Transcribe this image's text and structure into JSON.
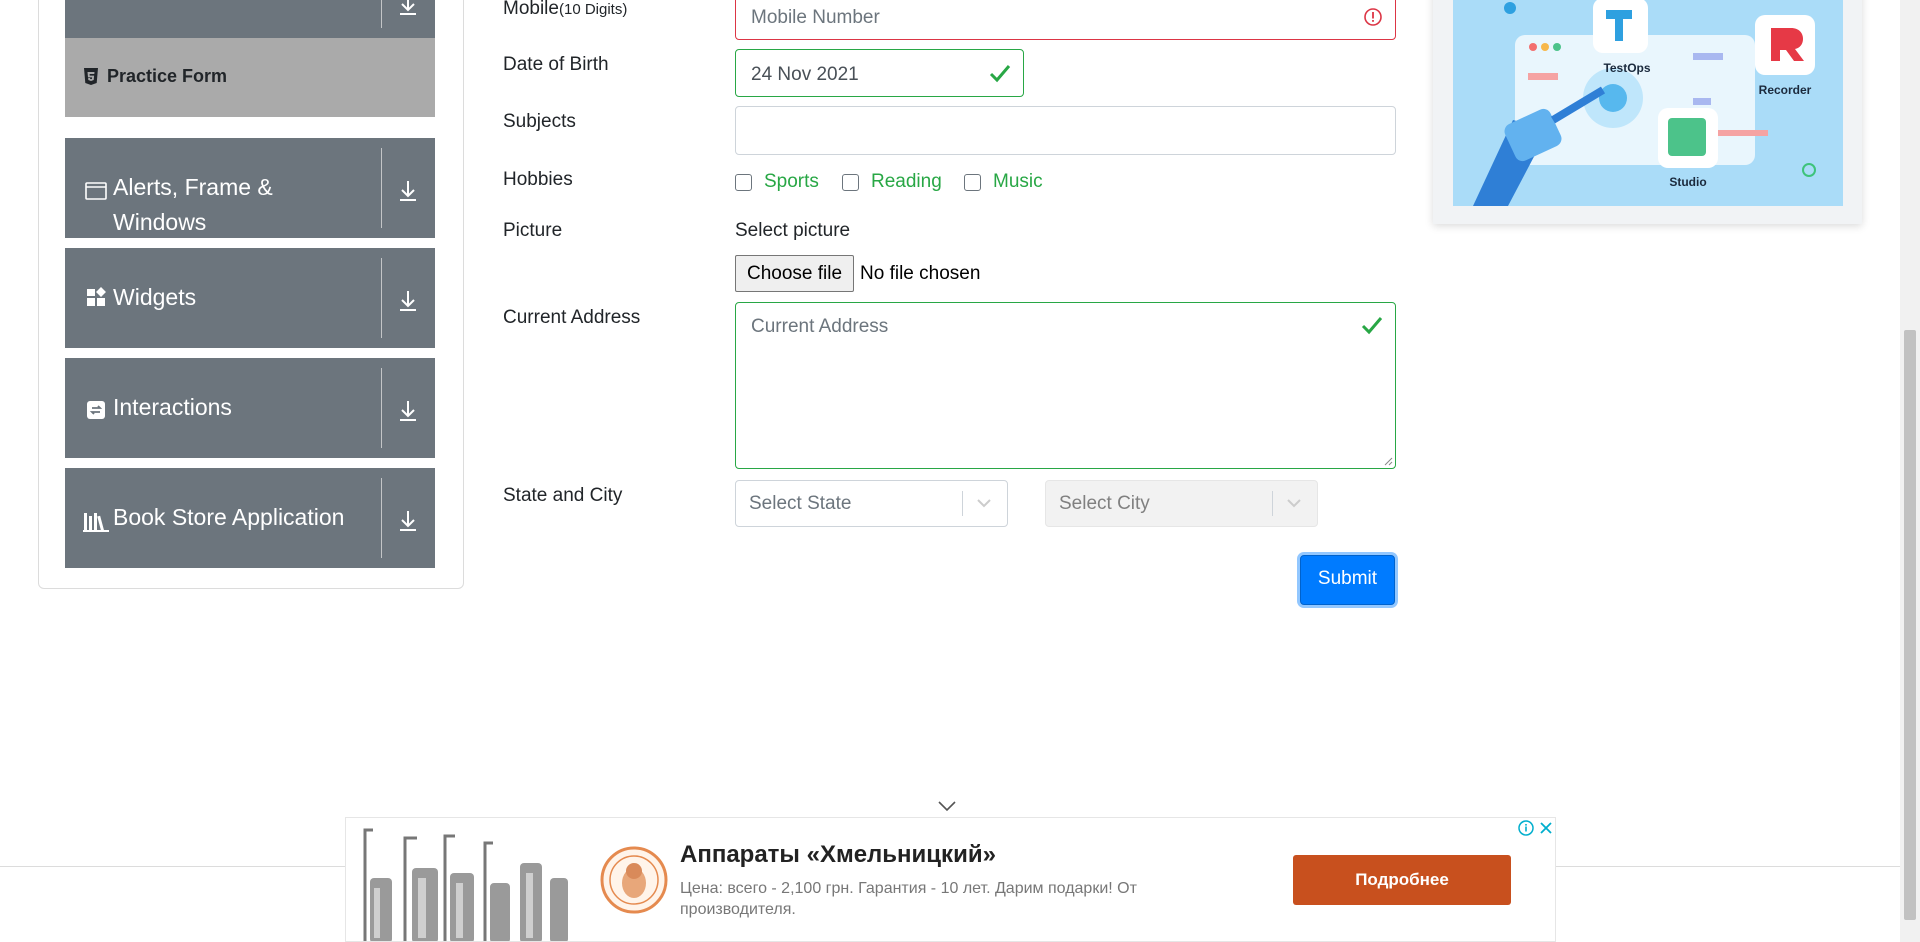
{
  "sidebar": {
    "active_item": "Practice Form",
    "groups": [
      {
        "label_line1": "Alerts, Frame &",
        "label_line2": "Windows",
        "icon": "window-icon"
      },
      {
        "label": "Widgets",
        "icon": "widgets-icon"
      },
      {
        "label": "Interactions",
        "icon": "interactions-icon"
      },
      {
        "label": "Book Store Application",
        "icon": "books-icon"
      }
    ]
  },
  "form": {
    "mobile_label": "Mobile",
    "mobile_hint": "(10 Digits)",
    "mobile_placeholder": "Mobile Number",
    "dob_label": "Date of Birth",
    "dob_value": "24 Nov 2021",
    "subjects_label": "Subjects",
    "hobbies_label": "Hobbies",
    "hobbies": [
      "Sports",
      "Reading",
      "Music"
    ],
    "picture_label": "Picture",
    "select_picture": "Select picture",
    "choose_file": "Choose file",
    "no_file": "No file chosen",
    "address_label": "Current Address",
    "address_placeholder": "Current Address",
    "state_city_label": "State and City",
    "state_placeholder": "Select State",
    "city_placeholder": "Select City",
    "submit": "Submit"
  },
  "promo": {
    "labels": [
      "TestOps",
      "Recorder",
      "Studio"
    ]
  },
  "ad": {
    "title": "Аппараты «Хмельницкий»",
    "description": "Цена: всего - 2,100 грн. Гарантия - 10 лет. Дарим подарки! От производителя.",
    "cta": "Подробнее"
  },
  "colors": {
    "sidebar_group": "#6c757d",
    "active_item": "#aaaaaa",
    "valid": "#28a745",
    "invalid": "#dc3545",
    "primary": "#007bff",
    "ad_cta": "#c8501e"
  }
}
